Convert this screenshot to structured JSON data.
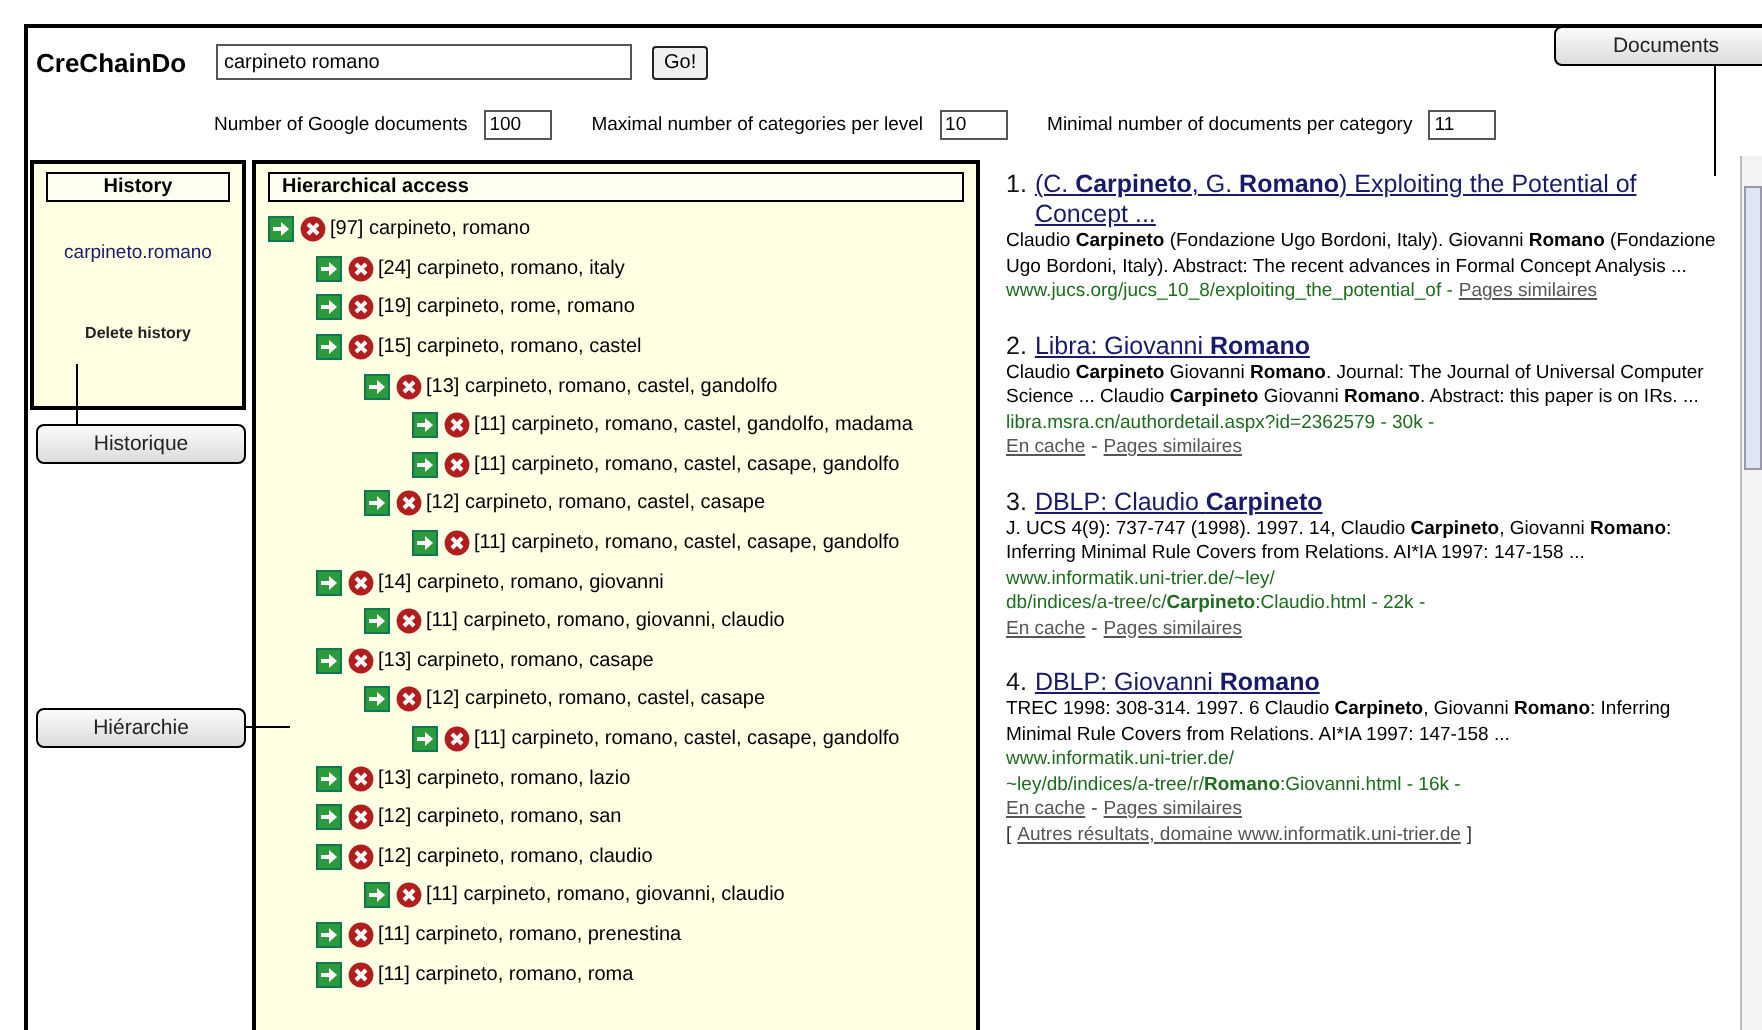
{
  "app": {
    "title": "CreChainDo",
    "search": {
      "value": "carpineto romano"
    },
    "go_button": "Go!"
  },
  "options": [
    {
      "label": "Number of Google documents",
      "value": "100"
    },
    {
      "label": "Maximal number of categories per level",
      "value": "10"
    },
    {
      "label": "Minimal number of documents per category",
      "value": "11"
    }
  ],
  "history": {
    "title": "History",
    "items": [
      "carpineto.romano"
    ],
    "delete": "Delete history"
  },
  "hierarchy": {
    "title": "Hierarchical access",
    "tree": [
      {
        "label": "[97] carpineto, romano",
        "children": [
          {
            "label": "[24] carpineto, romano, italy"
          },
          {
            "label": "[19] carpineto, rome, romano"
          },
          {
            "label": "[15] carpineto, romano, castel",
            "children": [
              {
                "label": "[13] carpineto, romano, castel, gandolfo",
                "children": [
                  {
                    "label": "[11] carpineto, romano, castel, gandolfo, madama"
                  },
                  {
                    "label": "[11] carpineto, romano, castel, casape, gandolfo"
                  }
                ]
              },
              {
                "label": "[12] carpineto, romano, castel, casape",
                "children": [
                  {
                    "label": "[11] carpineto, romano, castel, casape, gandolfo"
                  }
                ]
              }
            ]
          },
          {
            "label": "[14] carpineto, romano, giovanni",
            "children": [
              {
                "label": "[11] carpineto, romano, giovanni, claudio"
              }
            ]
          },
          {
            "label": "[13] carpineto, romano, casape",
            "children": [
              {
                "label": "[12] carpineto, romano, castel, casape",
                "children": [
                  {
                    "label": "[11] carpineto, romano, castel, casape, gandolfo"
                  }
                ]
              }
            ]
          },
          {
            "label": "[13] carpineto, romano, lazio"
          },
          {
            "label": "[12] carpineto, romano, san"
          },
          {
            "label": "[12] carpineto, romano, claudio",
            "children": [
              {
                "label": "[11] carpineto, romano, giovanni, claudio"
              }
            ]
          },
          {
            "label": "[11] carpineto, romano, prenestina"
          },
          {
            "label": "[11] carpineto, romano, roma"
          }
        ]
      }
    ]
  },
  "results": [
    {
      "number": "1.",
      "title": "(C. **Carpineto**, G. **Romano**) Exploiting the Potential of Concept ...",
      "snippet": "Claudio **Carpineto** (Fondazione Ugo Bordoni, Italy). Giovanni **Romano** (Fondazione Ugo Bordoni, Italy). Abstract: The recent advances in Formal Concept Analysis ...",
      "footer": [
        [
          {
            "kind": "url",
            "text": "www.jucs.org/jucs_10_8/exploiting_the_potential_of -"
          },
          {
            "kind": "link",
            "text": "Pages similaires"
          }
        ]
      ]
    },
    {
      "number": "2.",
      "title": "Libra: Giovanni **Romano**",
      "snippet": "Claudio **Carpineto** Giovanni **Romano**. Journal: The Journal of Universal Computer Science ... Claudio **Carpineto** Giovanni **Romano**. Abstract: this paper is on IRs. ...",
      "footer": [
        [
          {
            "kind": "url",
            "text": "libra.msra.cn/authordetail.aspx?id=2362579 - 30k -"
          }
        ],
        [
          {
            "kind": "link",
            "text": "En cache"
          },
          {
            "kind": "text",
            "text": "-"
          },
          {
            "kind": "link",
            "text": "Pages similaires"
          }
        ]
      ]
    },
    {
      "number": "3.",
      "title": "DBLP: Claudio **Carpineto**",
      "snippet": "J. UCS 4(9): 737-747 (1998). 1997. 14, Claudio **Carpineto**, Giovanni **Romano**: Inferring Minimal Rule Covers from Relations. AI*IA 1997: 147-158 ...",
      "footer": [
        [
          {
            "kind": "url",
            "text": "www.informatik.uni-trier.de/~ley/"
          }
        ],
        [
          {
            "kind": "url",
            "text": "db/indices/a-tree/c/**Carpineto**:Claudio.html - 22k -"
          }
        ],
        [
          {
            "kind": "link",
            "text": "En cache"
          },
          {
            "kind": "text",
            "text": "-"
          },
          {
            "kind": "link",
            "text": "Pages similaires"
          }
        ]
      ]
    },
    {
      "number": "4.",
      "title": "DBLP: Giovanni **Romano**",
      "snippet": "TREC 1998: 308-314. 1997. 6 Claudio **Carpineto**, Giovanni **Romano**: Inferring Minimal Rule Covers from Relations. AI*IA 1997: 147-158 ...",
      "footer": [
        [
          {
            "kind": "url",
            "text": "www.informatik.uni-trier.de/"
          }
        ],
        [
          {
            "kind": "url",
            "text": "~ley/db/indices/a-tree/r/**Romano**:Giovanni.html - 16k -"
          }
        ],
        [
          {
            "kind": "link",
            "text": "En cache"
          },
          {
            "kind": "text",
            "text": "-"
          },
          {
            "kind": "link",
            "text": "Pages similaires"
          }
        ],
        [
          {
            "kind": "text",
            "text": "["
          },
          {
            "kind": "link",
            "text": "Autres résultats, domaine www.informatik.uni-trier.de"
          },
          {
            "kind": "text",
            "text": "]"
          }
        ]
      ]
    }
  ],
  "callouts": [
    {
      "label": "Historique"
    },
    {
      "label": "Hiérarchie"
    },
    {
      "label": "Documents"
    }
  ]
}
